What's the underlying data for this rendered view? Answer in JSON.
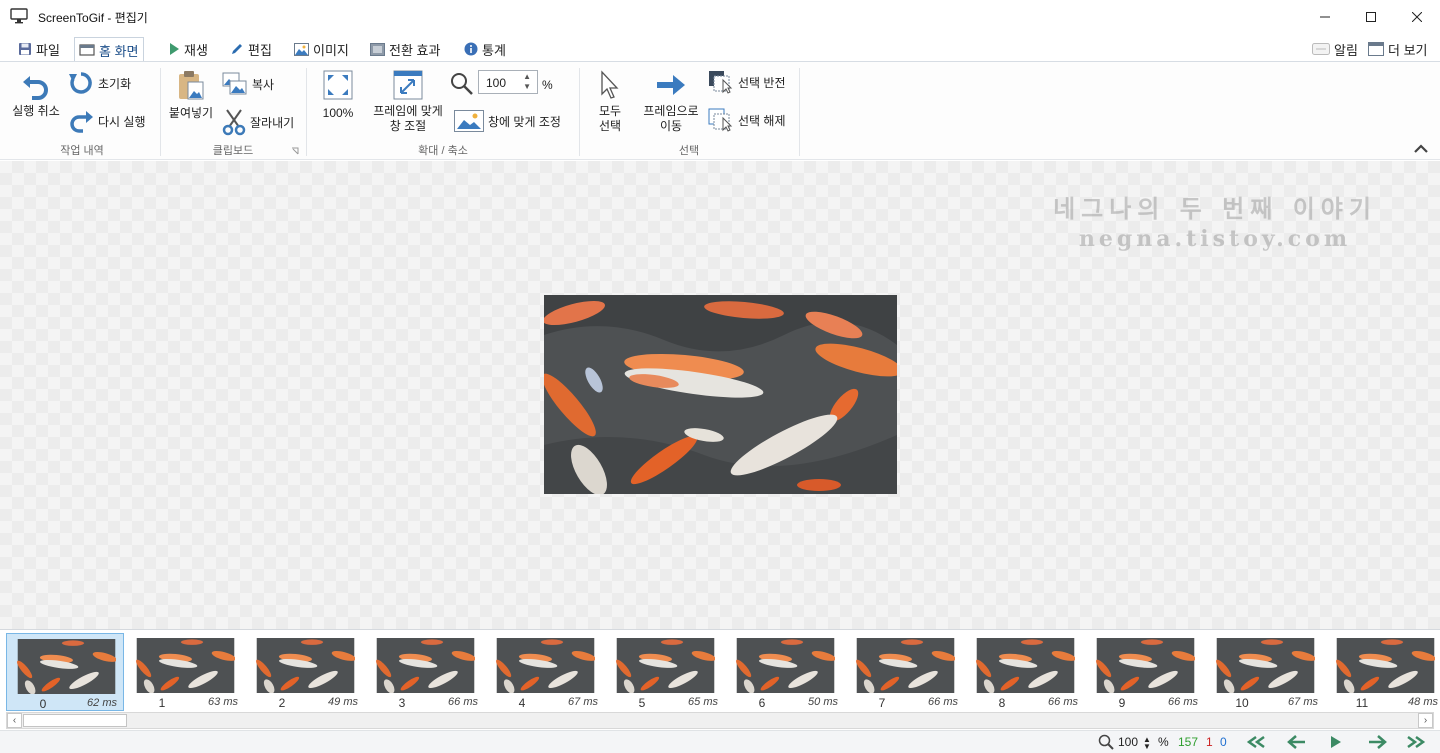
{
  "window": {
    "title": "ScreenToGif - 편집기",
    "icon": "monitor-icon"
  },
  "tabs": [
    {
      "label": "파일",
      "icon": "save-icon"
    },
    {
      "label": "홈 화면",
      "icon": "home-icon",
      "active": true
    },
    {
      "label": "재생",
      "icon": "play-icon"
    },
    {
      "label": "편집",
      "icon": "pencil-icon"
    },
    {
      "label": "이미지",
      "icon": "image-icon"
    },
    {
      "label": "전환 효과",
      "icon": "transition-icon"
    },
    {
      "label": "통계",
      "icon": "info-icon"
    }
  ],
  "right_tabs": {
    "notifications": "알림",
    "more": "더 보기"
  },
  "ribbon": {
    "history": {
      "label": "작업 내역",
      "undo": "실행 취소",
      "reset": "초기화",
      "redo": "다시 실행"
    },
    "clipboard": {
      "label": "클립보드",
      "paste": "붙여넣기",
      "copy": "복사",
      "cut": "잘라내기"
    },
    "zoom": {
      "label": "확대 / 축소",
      "zoom100": "100%",
      "fit_frame_line1": "프레임에 맞게",
      "fit_frame_line2": "창 조절",
      "zoom_value": "100",
      "zoom_unit": "%",
      "fit_window": "창에 맞게 조정"
    },
    "selection": {
      "label": "선택",
      "select_all_line1": "모두",
      "select_all_line2": "선택",
      "goto_line1": "프레임으로",
      "goto_line2": "이동",
      "invert": "선택 반전",
      "deselect": "선택 해제"
    }
  },
  "watermark": {
    "line1": "네그나의 두 번째 이야기",
    "line2": "negna.tistoy.com"
  },
  "frames": [
    {
      "index": "0",
      "delay": "62 ms",
      "selected": true
    },
    {
      "index": "1",
      "delay": "63 ms"
    },
    {
      "index": "2",
      "delay": "49 ms"
    },
    {
      "index": "3",
      "delay": "66 ms"
    },
    {
      "index": "4",
      "delay": "67 ms"
    },
    {
      "index": "5",
      "delay": "65 ms"
    },
    {
      "index": "6",
      "delay": "50 ms"
    },
    {
      "index": "7",
      "delay": "66 ms"
    },
    {
      "index": "8",
      "delay": "66 ms"
    },
    {
      "index": "9",
      "delay": "66 ms"
    },
    {
      "index": "10",
      "delay": "67 ms"
    },
    {
      "index": "11",
      "delay": "48 ms"
    }
  ],
  "status": {
    "zoom_value": "100",
    "zoom_unit": "%",
    "frame_count": "157",
    "selected_count": "1",
    "selected_index": "0"
  },
  "colors": {
    "accent": "#1f7fd0",
    "count_green": "#2e9e2e",
    "count_red": "#cc2222",
    "count_blue": "#1f6fd0",
    "nav_green": "#3c8a64"
  }
}
